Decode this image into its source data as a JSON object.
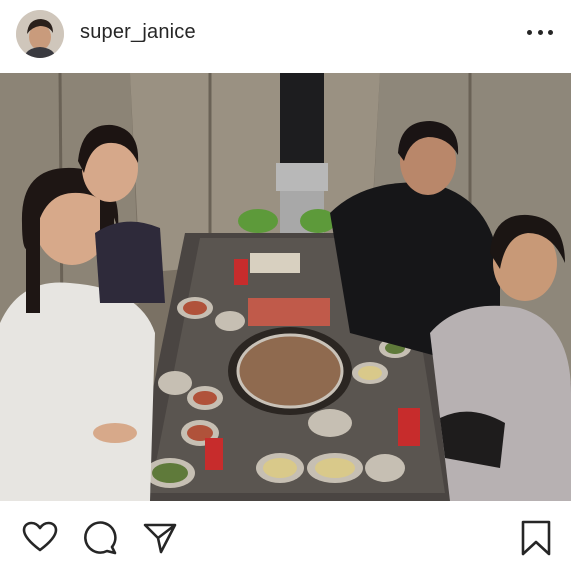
{
  "post": {
    "username": "super_janice"
  },
  "icons": {
    "more": "more-options-icon",
    "like": "heart-icon",
    "comment": "comment-bubble-icon",
    "share": "send-paper-plane-icon",
    "save": "bookmark-icon"
  },
  "colors": {
    "text": "#262626",
    "background": "#ffffff"
  }
}
